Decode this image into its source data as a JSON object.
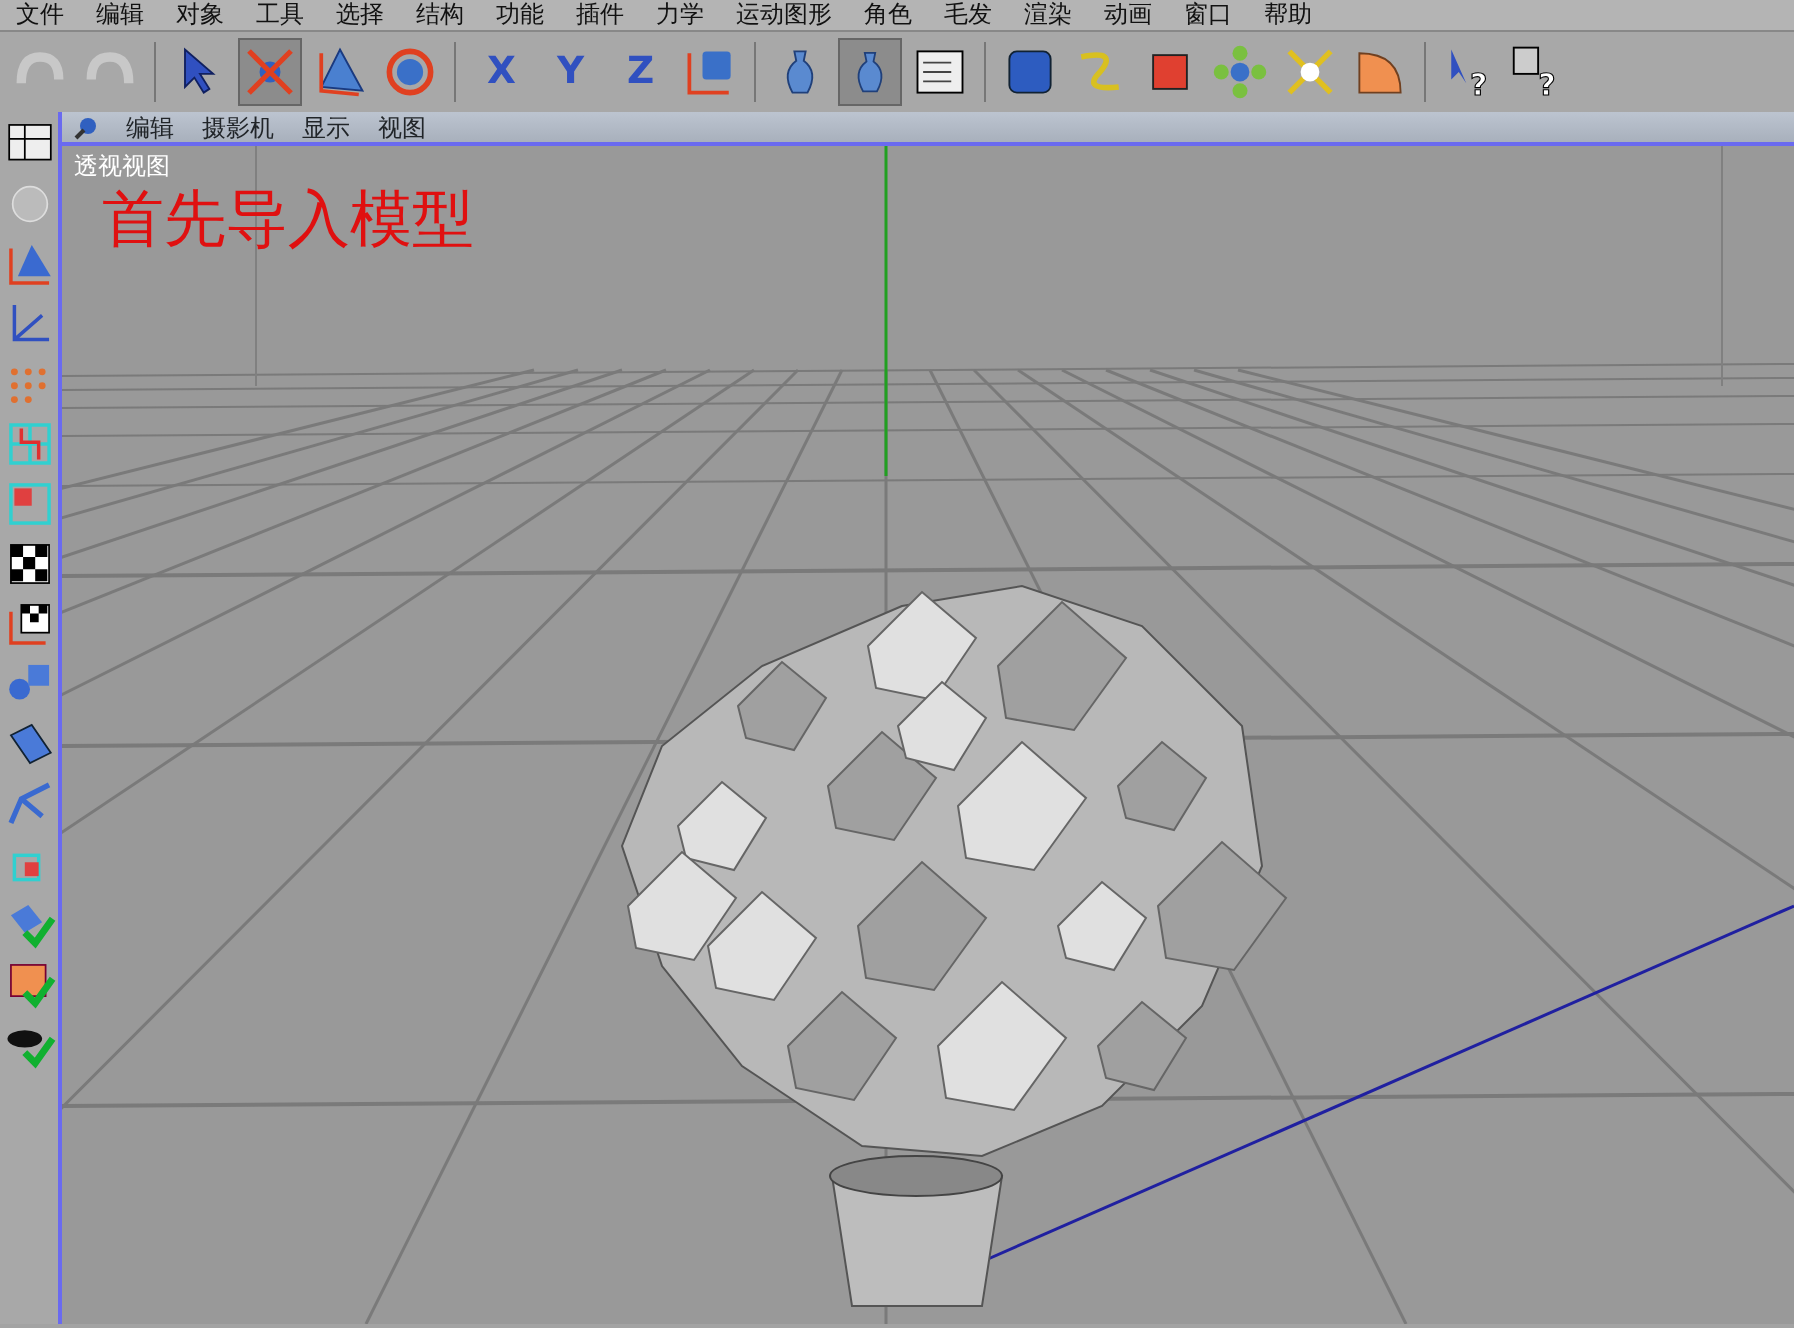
{
  "menu_bar": {
    "items": [
      "文件",
      "编辑",
      "对象",
      "工具",
      "选择",
      "结构",
      "功能",
      "插件",
      "力学",
      "运动图形",
      "角色",
      "毛发",
      "渲染",
      "动画",
      "窗口",
      "帮助"
    ]
  },
  "toolbar": {
    "glyphs": [
      "X",
      "Y",
      "Z",
      "?",
      "?"
    ]
  },
  "viewport": {
    "menu": [
      "编辑",
      "摄影机",
      "显示",
      "视图"
    ],
    "title": "透视视图",
    "caption": "首先导入模型"
  }
}
